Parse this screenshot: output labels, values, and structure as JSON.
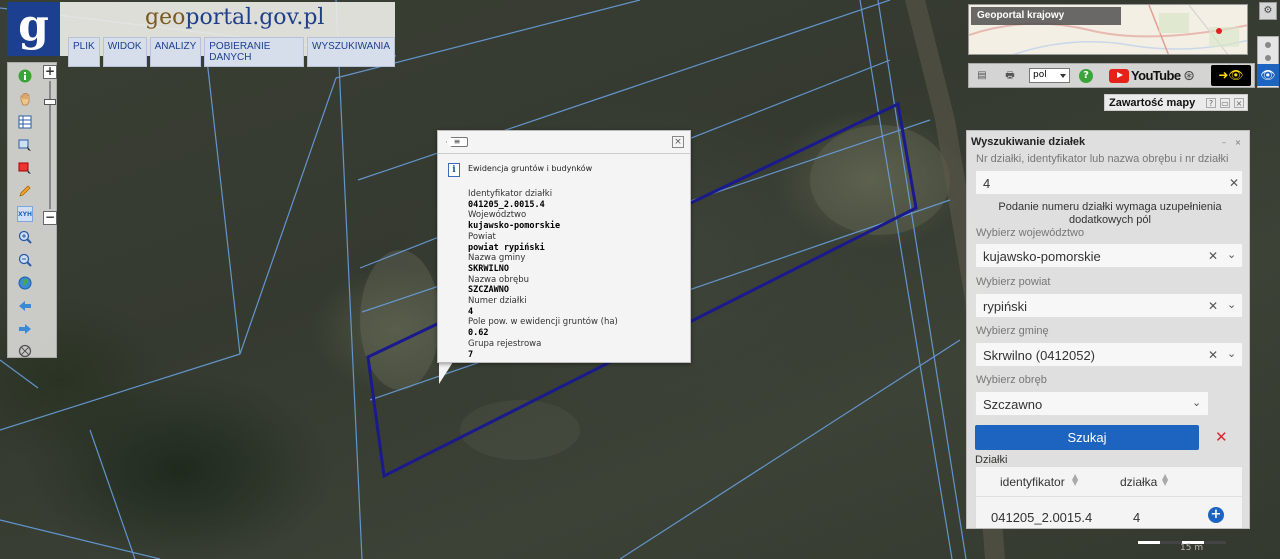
{
  "brand": {
    "part1": "geo",
    "part2": "portal.gov.pl",
    "logo_letter": "g"
  },
  "menu": [
    "PLIK",
    "WIDOK",
    "ANALIZY",
    "POBIERANIE DANYCH",
    "WYSZUKIWANIA"
  ],
  "toolbar": {
    "icons": [
      "info-icon",
      "pan-hand-icon",
      "layers-table-icon",
      "select-area-icon",
      "clear-selection-icon",
      "draw-pencil-icon",
      "xyh-coordinates-icon",
      "zoom-in-icon",
      "zoom-out-icon",
      "globe-icon",
      "back-arrow-icon",
      "forward-arrow-icon",
      "full-extent-icon"
    ],
    "xyh_label": "XYH",
    "zoom_plus": "+",
    "zoom_minus": "−"
  },
  "popup": {
    "section": "Ewidencja gruntów i budynków",
    "fields": [
      {
        "label": "Identyfikator działki",
        "value": "041205_2.0015.4"
      },
      {
        "label": "Województwo",
        "value": "kujawsko-pomorskie"
      },
      {
        "label": "Powiat",
        "value": "powiat rypiński"
      },
      {
        "label": "Nazwa gminy",
        "value": "SKRWILNO"
      },
      {
        "label": "Nazwa obrębu",
        "value": "SZCZAWNO"
      },
      {
        "label": "Numer działki",
        "value": "4"
      },
      {
        "label": "Pole pow. w ewidencji gruntów (ha)",
        "value": "0.62"
      },
      {
        "label": "Grupa rejestrowa",
        "value": "7"
      }
    ]
  },
  "overview": {
    "title": "Geoportal krajowy"
  },
  "toolbar2": {
    "language": "pol",
    "youtube": "YouTube"
  },
  "map_contents": {
    "title": "Zawartość mapy",
    "help": "?"
  },
  "parcel_search": {
    "title": "Wyszukiwanie działek",
    "query_label": "Nr działki, identyfikator lub nazwa obrębu i nr działki",
    "query_value": "4",
    "note": "Podanie numeru działki wymaga uzupełnienia dodatkowych pól",
    "voivodeship_label": "Wybierz województwo",
    "voivodeship_value": "kujawsko-pomorskie",
    "county_label": "Wybierz powiat",
    "county_value": "rypiński",
    "commune_label": "Wybierz gminę",
    "commune_value": "Skrwilno (0412052)",
    "precinct_label": "Wybierz obręb",
    "precinct_value": "Szczawno",
    "search_button": "Szukaj",
    "results_label": "Działki",
    "columns": [
      "identyfikator",
      "działka"
    ],
    "rows": [
      {
        "identyfikator": "041205_2.0015.4",
        "dzialka": "4"
      }
    ]
  },
  "scale": {
    "label": "15 m"
  },
  "colors": {
    "accent": "#1d64c0",
    "parcel_outline": "#1a1a8c",
    "parcel_boundaries": "#6aa4e8",
    "logo": "#1c3f8f"
  }
}
